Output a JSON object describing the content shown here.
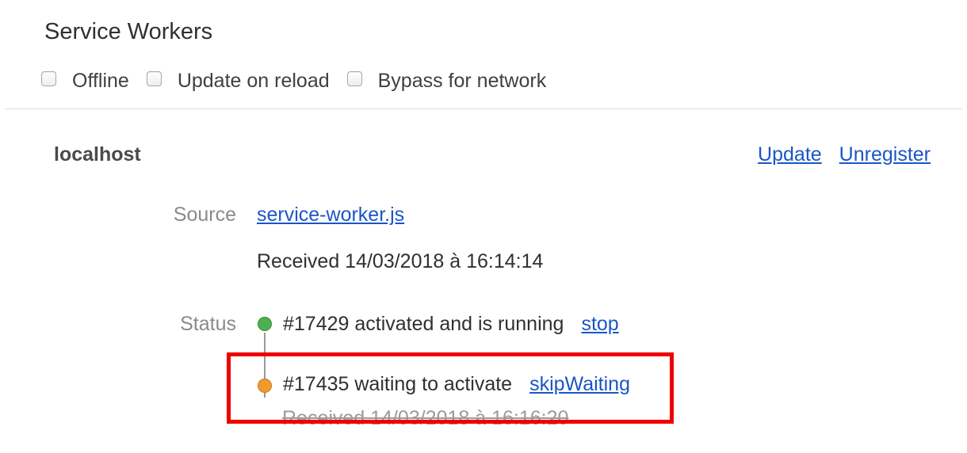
{
  "header": {
    "title": "Service Workers"
  },
  "toolbar": {
    "options": [
      {
        "label": "Offline",
        "checked": false
      },
      {
        "label": "Update on reload",
        "checked": false
      },
      {
        "label": "Bypass for network",
        "checked": false
      }
    ]
  },
  "registration": {
    "origin": "localhost",
    "update_label": "Update",
    "unregister_label": "Unregister",
    "source_label": "Source",
    "source_file": "service-worker.js",
    "received": "Received 14/03/2018 à 16:14:14",
    "status_label": "Status",
    "workers": [
      {
        "text": "#17429 activated and is running",
        "action": "stop",
        "color": "#4caf50"
      },
      {
        "text": "#17435 waiting to activate",
        "action": "skipWaiting",
        "color": "#f29a2e"
      }
    ],
    "waiting_received": "Received 14/03/2018 à 16:16:20"
  },
  "annotation": {
    "color": "#f00000"
  }
}
